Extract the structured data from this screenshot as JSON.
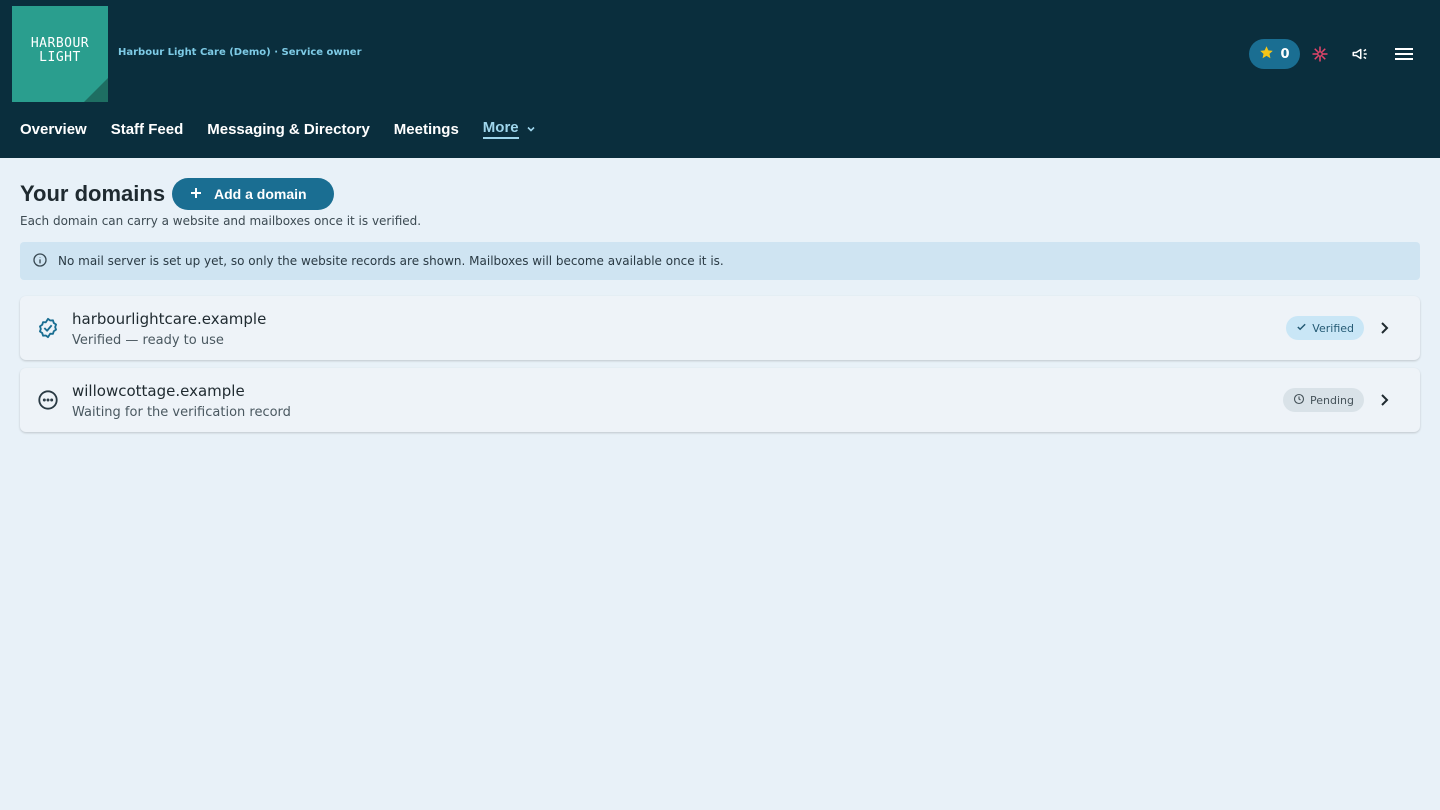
{
  "header": {
    "logo_text": "HARBOUR\nLIGHT",
    "org_line": "Harbour Light Care (Demo) · Service owner",
    "stars_count": "0",
    "nav": [
      {
        "label": "Overview"
      },
      {
        "label": "Staff Feed"
      },
      {
        "label": "Messaging & Directory"
      },
      {
        "label": "Meetings"
      },
      {
        "label": "More"
      }
    ]
  },
  "main": {
    "title": "Your domains",
    "add_button_label": "Add a domain",
    "subtitle": "Each domain can carry a website and mailboxes once it is verified.",
    "info_banner": "No mail server is set up yet, so only the website records are shown. Mailboxes will become available once it is.",
    "domains": [
      {
        "name": "harbourlightcare.example",
        "description": "Verified — ready to use",
        "badge": "Verified",
        "status": "verified"
      },
      {
        "name": "willowcottage.example",
        "description": "Waiting for the verification record",
        "badge": "Pending",
        "status": "pending"
      }
    ]
  },
  "colors": {
    "header_bg": "#0a2e3d",
    "accent": "#1a6e92",
    "logo_bg": "#2a9e8e",
    "page_bg": "#e8f1f8",
    "star": "#f5c518",
    "alert_icon": "#e8456b"
  }
}
